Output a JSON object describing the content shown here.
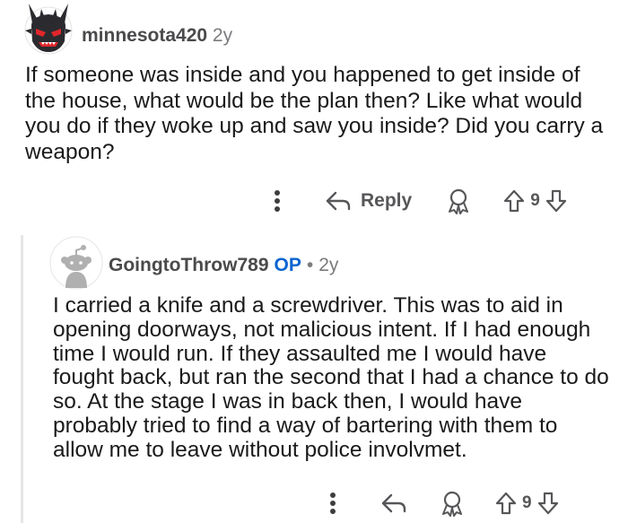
{
  "parent_comment": {
    "username": "minnesota420",
    "age": "2y",
    "body": "If someone was inside and you happened to get inside of the house, what would be the plan then? Like what would you do if they woke up and saw you inside? Did you carry a weapon?",
    "actions": {
      "more_icon": "more-vertical-icon",
      "reply_label": "Reply",
      "award_icon": "award-icon",
      "vote_count": "9"
    }
  },
  "reply_comment": {
    "username": "GoingtoThrow789",
    "op_tag": "OP",
    "separator": "•",
    "age": "2y",
    "body": "I carried a knife and a screwdriver. This was to aid in opening doorways, not malicious intent. If I had enough time I would run. If they assaulted me I would have fought back, but ran the second that I had a chance to do so. At the stage I was in back then, I would have probably tried to find a way of bartering with them to allow me to leave without police involvmet.",
    "actions": {
      "more_icon": "more-vertical-icon",
      "award_icon": "award-icon",
      "vote_count": "9"
    }
  },
  "colors": {
    "op_blue": "#0a64d0",
    "text": "#1a1a1b",
    "muted": "#7c7c7f",
    "avatar_red": "#e0262b"
  }
}
